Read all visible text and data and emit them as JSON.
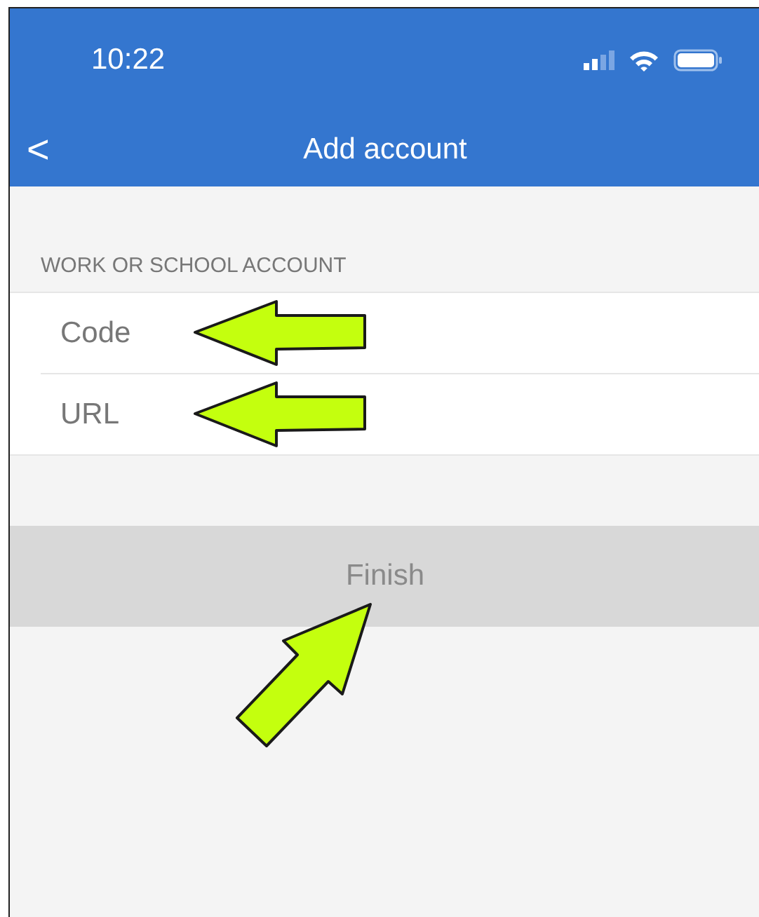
{
  "status_bar": {
    "time": "10:22"
  },
  "nav_bar": {
    "back": "<",
    "title": "Add account"
  },
  "section": {
    "header": "WORK OR SCHOOL ACCOUNT",
    "fields": [
      {
        "placeholder": "Code",
        "highlighted": true
      },
      {
        "placeholder": "URL",
        "highlighted": true
      }
    ]
  },
  "finish_button": {
    "label": "Finish",
    "disabled": true,
    "highlighted": true
  }
}
